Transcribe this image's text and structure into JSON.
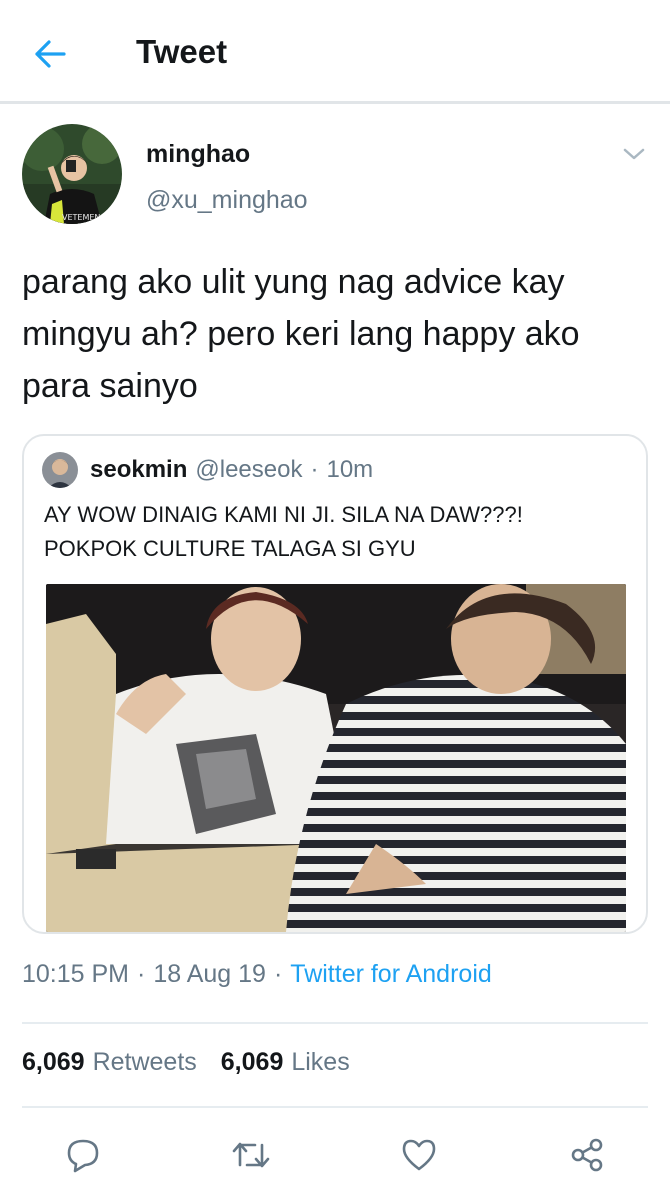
{
  "header": {
    "title": "Tweet",
    "back_icon": "arrow-left-icon"
  },
  "tweet": {
    "author_name": "minghao",
    "author_handle": "@xu_minghao",
    "text": "parang ako ulit yung nag advice kay mingyu ah? pero keri lang happy ako para sainyo",
    "time": "10:15 PM",
    "date": "18 Aug 19",
    "source": "Twitter for Android"
  },
  "quoted": {
    "name": "seokmin",
    "handle": "@leeseok",
    "time": "10m",
    "line1": "AY WOW DINAIG KAMI NI JI. SILA NA DAW???!",
    "line2": "POKPOK CULTURE TALAGA SI GYU"
  },
  "stats": {
    "retweets_count": "6,069",
    "retweets_label": "Retweets",
    "likes_count": "6,069",
    "likes_label": "Likes"
  },
  "actions": [
    "reply-icon",
    "retweet-icon",
    "like-icon",
    "share-icon"
  ],
  "colors": {
    "accent": "#1da1f2",
    "text": "#14171a",
    "muted": "#657786",
    "border": "#e1e5e8"
  }
}
